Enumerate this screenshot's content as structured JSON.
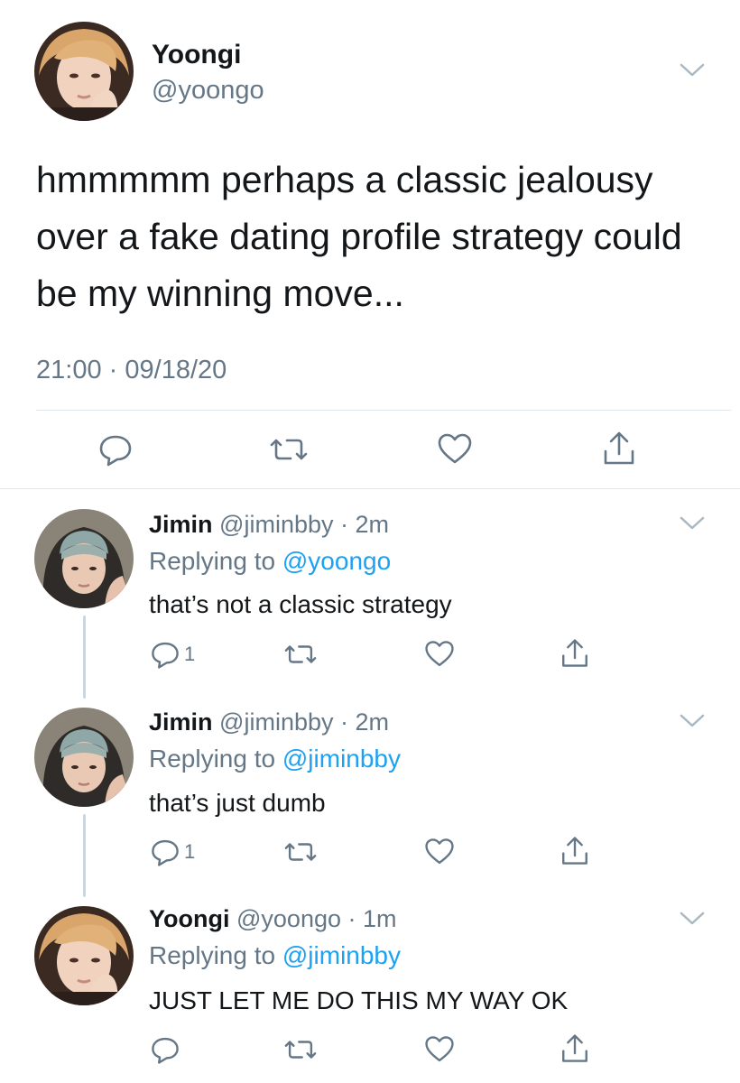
{
  "main_tweet": {
    "name": "Yoongi",
    "handle": "@yoongo",
    "text": "hmmmmm perhaps a classic jealousy over a fake dating profile strategy could be my winning move...",
    "time": "21:00",
    "separator": "·",
    "date": "09/18/20",
    "actions": [
      "reply-icon",
      "retweet-icon",
      "like-icon",
      "share-icon"
    ]
  },
  "replies": [
    {
      "name": "Jimin",
      "handle": "@jiminbby",
      "separator": "·",
      "time": "2m",
      "replying_label": "Replying to",
      "replying_to": "@yoongo",
      "text": "that’s not a classic strategy",
      "reply_count": "1"
    },
    {
      "name": "Jimin",
      "handle": "@jiminbby",
      "separator": "·",
      "time": "2m",
      "replying_label": "Replying to",
      "replying_to": "@jiminbby",
      "text": "that’s just dumb",
      "reply_count": "1"
    },
    {
      "name": "Yoongi",
      "handle": "@yoongo",
      "separator": "·",
      "time": "1m",
      "replying_label": "Replying to",
      "replying_to": "@jiminbby",
      "text": "JUST LET ME DO THIS MY WAY OK",
      "reply_count": ""
    }
  ],
  "colors": {
    "text": "#14171a",
    "muted": "#657786",
    "link": "#1da1f2",
    "border": "#e1e8ed",
    "thread": "#ccd6dd"
  }
}
